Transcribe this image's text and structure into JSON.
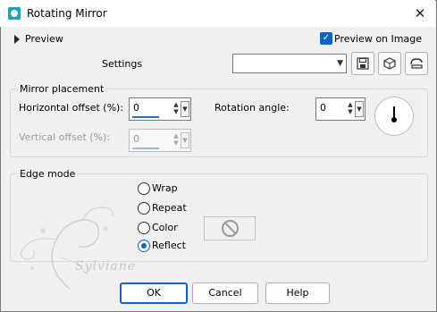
{
  "window": {
    "title": "Rotating Mirror",
    "close_glyph": "✕"
  },
  "preview": {
    "label": "Preview",
    "preview_on_image_label": "Preview on Image",
    "preview_on_image_checked": true
  },
  "settings": {
    "label": "Settings",
    "preset_value": "",
    "icons": [
      "save-icon",
      "cube-icon",
      "reset-icon"
    ]
  },
  "mirror_placement": {
    "title": "Mirror placement",
    "horizontal_offset": {
      "label": "Horizontal offset (%):",
      "value": "0"
    },
    "vertical_offset": {
      "label": "Vertical offset (%):",
      "value": "0",
      "disabled": true
    },
    "rotation_angle": {
      "label": "Rotation angle:",
      "value": "0"
    }
  },
  "edge_mode": {
    "title": "Edge mode",
    "options": [
      {
        "label": "Wrap",
        "selected": false
      },
      {
        "label": "Repeat",
        "selected": false
      },
      {
        "label": "Color",
        "selected": false
      },
      {
        "label": "Reflect",
        "selected": true
      }
    ]
  },
  "watermark": {
    "text": "Sylviane"
  },
  "buttons": {
    "ok": "OK",
    "cancel": "Cancel",
    "help": "Help"
  },
  "colors": {
    "accent": "#0a64c8",
    "app_icon": "#1b9fc7",
    "background": "#f0f0f0"
  }
}
